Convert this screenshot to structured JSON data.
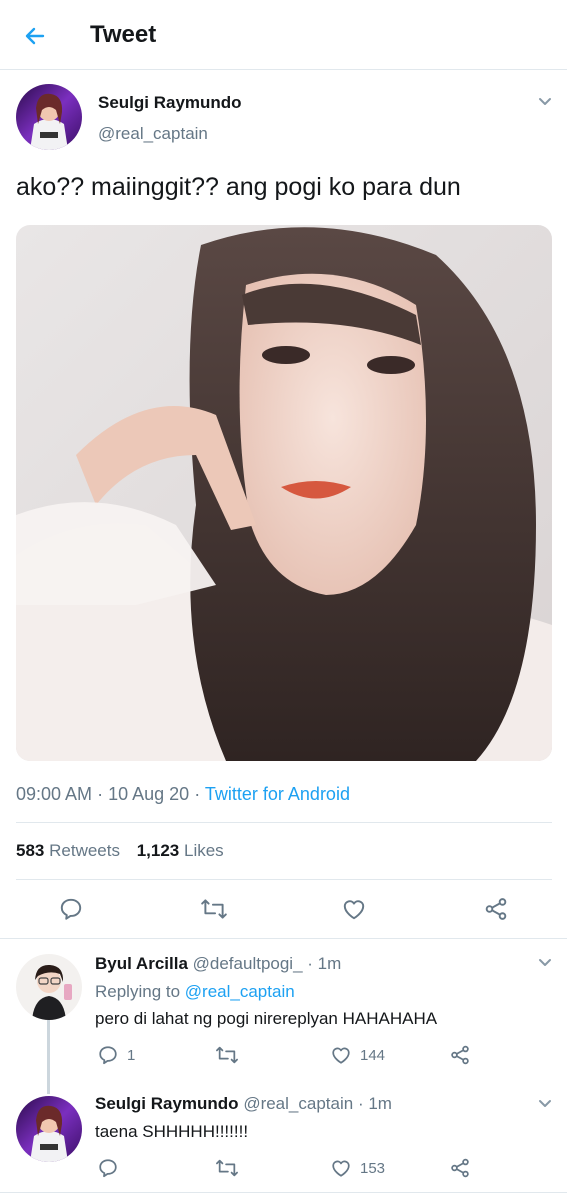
{
  "header": {
    "title": "Tweet"
  },
  "main_tweet": {
    "author_name": "Seulgi Raymundo",
    "author_handle": "@real_captain",
    "text": "ako?? maiinggit?? ang pogi ko para dun",
    "time": "09:00 AM",
    "sep1": "·",
    "date": "10 Aug 20",
    "sep2": "·",
    "source": "Twitter for Android",
    "retweets_count": "583",
    "retweets_label": "Retweets",
    "likes_count": "1,123",
    "likes_label": "Likes"
  },
  "replies": [
    {
      "author_name": "Byul Arcilla",
      "author_handle": "@defaultpogi_",
      "age": "· 1m",
      "replying_prefix": "Replying to",
      "replying_handle": "@real_captain",
      "text": "pero di lahat ng pogi nirereplyan HAHAHAHA",
      "reply_count": "1",
      "retweet_count": "",
      "like_count": "144"
    },
    {
      "author_name": "Seulgi Raymundo",
      "author_handle": "@real_captain",
      "age": "· 1m",
      "text": "taena SHHHHH!!!!!!!",
      "reply_count": "",
      "retweet_count": "",
      "like_count": "153"
    }
  ],
  "colors": {
    "accent": "#1da1f2",
    "muted": "#657786",
    "border": "#e1e8ed",
    "icon": "#657786"
  },
  "icons": [
    "back-arrow-icon",
    "chevron-down-icon",
    "reply-icon",
    "retweet-icon",
    "like-icon",
    "share-icon"
  ]
}
